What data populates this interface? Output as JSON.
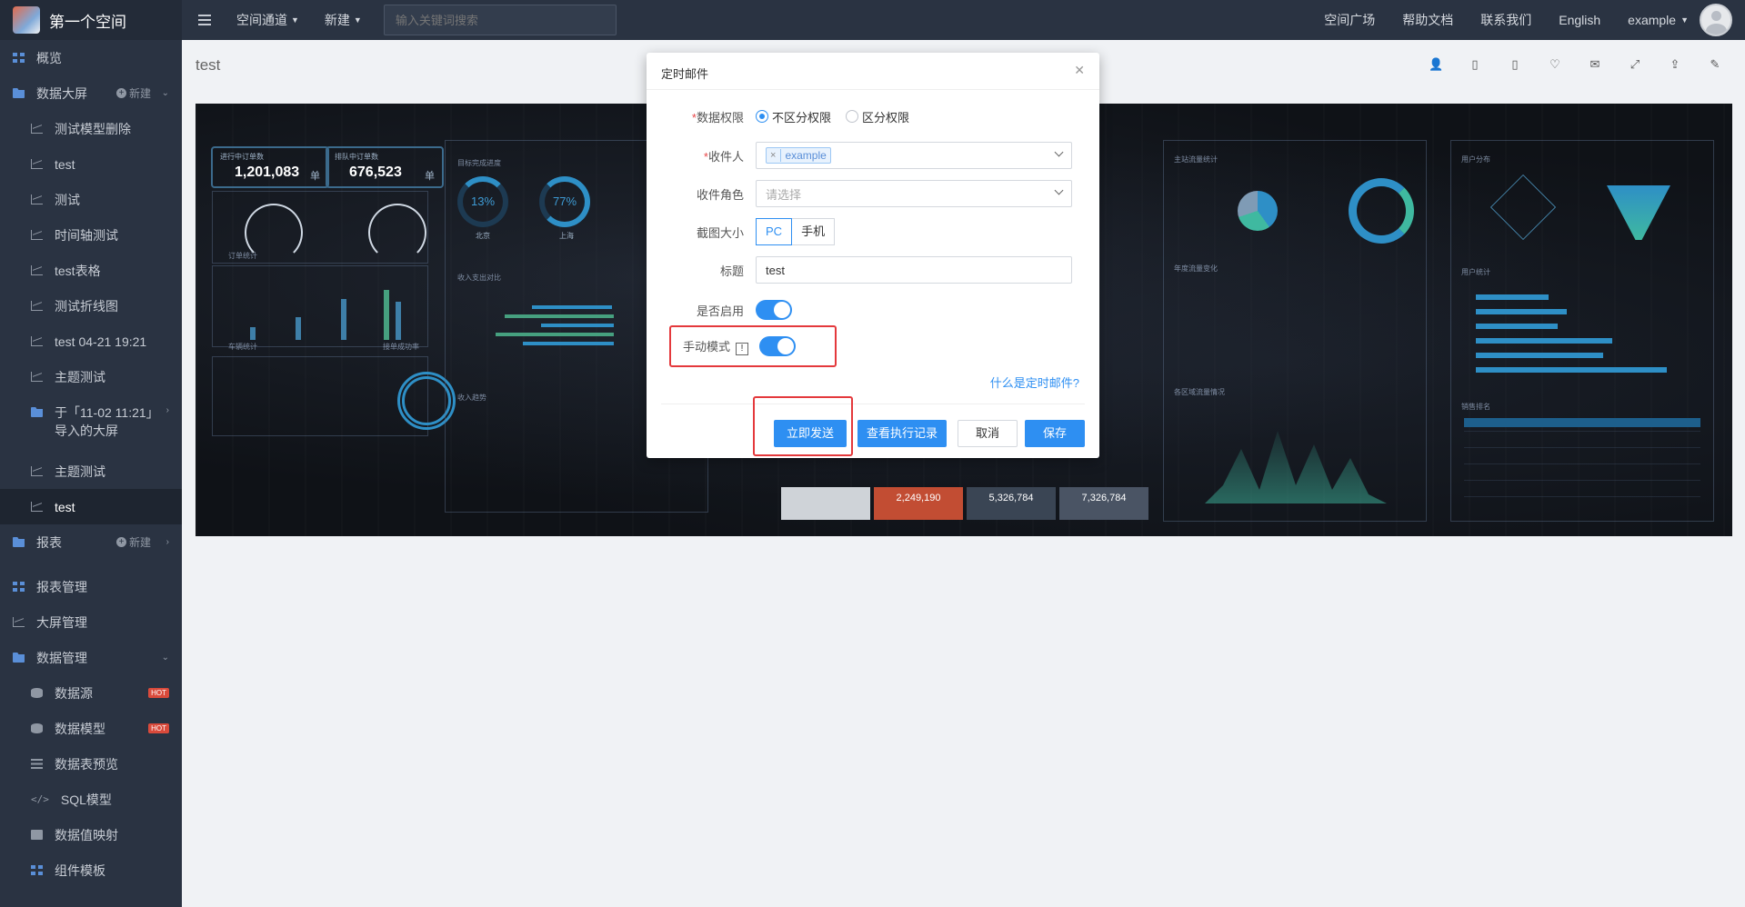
{
  "brand": {
    "title": "第一个空间"
  },
  "sidebar": {
    "items": [
      {
        "label": "概览",
        "icon": "grid-icon"
      },
      {
        "label": "数据大屏",
        "icon": "folder-icon",
        "new_label": "新建"
      },
      {
        "label": "测试模型删除",
        "icon": "line-chart-icon"
      },
      {
        "label": "test",
        "icon": "line-chart-icon"
      },
      {
        "label": "测试",
        "icon": "line-chart-icon"
      },
      {
        "label": "时间轴测试",
        "icon": "line-chart-icon"
      },
      {
        "label": "test表格",
        "icon": "line-chart-icon"
      },
      {
        "label": "测试折线图",
        "icon": "line-chart-icon"
      },
      {
        "label": "test 04-21 19:21",
        "icon": "line-chart-icon"
      },
      {
        "label": "主题测试",
        "icon": "line-chart-icon"
      },
      {
        "label": "于「11-02 11:21」导入的大屏",
        "icon": "folder-icon"
      },
      {
        "label": "主题测试",
        "icon": "line-chart-icon"
      },
      {
        "label": "test",
        "icon": "line-chart-icon"
      },
      {
        "label": "报表",
        "icon": "folder-icon",
        "new_label": "新建"
      },
      {
        "label": "报表管理",
        "icon": "grid-icon"
      },
      {
        "label": "大屏管理",
        "icon": "line-chart-icon"
      },
      {
        "label": "数据管理",
        "icon": "folder-icon"
      },
      {
        "label": "数据源",
        "icon": "database-icon",
        "badge": "HOT"
      },
      {
        "label": "数据模型",
        "icon": "model-icon",
        "badge": "HOT"
      },
      {
        "label": "数据表预览",
        "icon": "list-icon"
      },
      {
        "label": "SQL模型",
        "icon": "code-icon"
      },
      {
        "label": "数据值映射",
        "icon": "book-icon"
      },
      {
        "label": "组件模板",
        "icon": "template-icon"
      }
    ]
  },
  "topbar": {
    "channel": "空间通道",
    "create": "新建",
    "search_placeholder": "输入关键词搜索",
    "plaza": "空间广场",
    "docs": "帮助文档",
    "contact": "联系我们",
    "lang": "English",
    "user": "example"
  },
  "page": {
    "title": "test"
  },
  "dashboard": {
    "kpi1_label": "进行中订单数",
    "kpi1_value": "1,201,083",
    "kpi1_unit": "单",
    "kpi2_label": "排队中订单数",
    "kpi2_value": "676,523",
    "kpi2_unit": "单",
    "ring1": "13%",
    "ring2": "77%",
    "city1": "北京",
    "city2": "上海",
    "target_label": "目标完成进度",
    "income_compare": "收入支出对比",
    "income_trend": "收入趋势",
    "order_stats": "订单统计",
    "car_stats": "车辆统计",
    "order_rate": "接单成功率",
    "main_flow": "主站流量统计",
    "year_flow": "年度流量变化",
    "region_flow": "各区域流量情况",
    "user_dist": "用户分布",
    "user_stats": "用户统计",
    "sales_rank": "销售排名",
    "stat2": "2,249,190",
    "stat3": "5,326,784",
    "stat4": "7,326,784"
  },
  "modal": {
    "title": "定时邮件",
    "perm_label": "数据权限",
    "perm_opt1": "不区分权限",
    "perm_opt2": "区分权限",
    "recipient_label": "收件人",
    "recipient_tag": "example",
    "role_label": "收件角色",
    "role_placeholder": "请选择",
    "size_label": "截图大小",
    "size_pc": "PC",
    "size_mobile": "手机",
    "subject_label": "标题",
    "subject_value": "test",
    "enable_label": "是否启用",
    "manual_label": "手动模式",
    "help_link": "什么是定时邮件?",
    "send_now": "立即发送",
    "view_log": "查看执行记录",
    "cancel": "取消",
    "save": "保存",
    "accent_color": "#2e8ff2",
    "highlight_color": "#e4393c"
  }
}
